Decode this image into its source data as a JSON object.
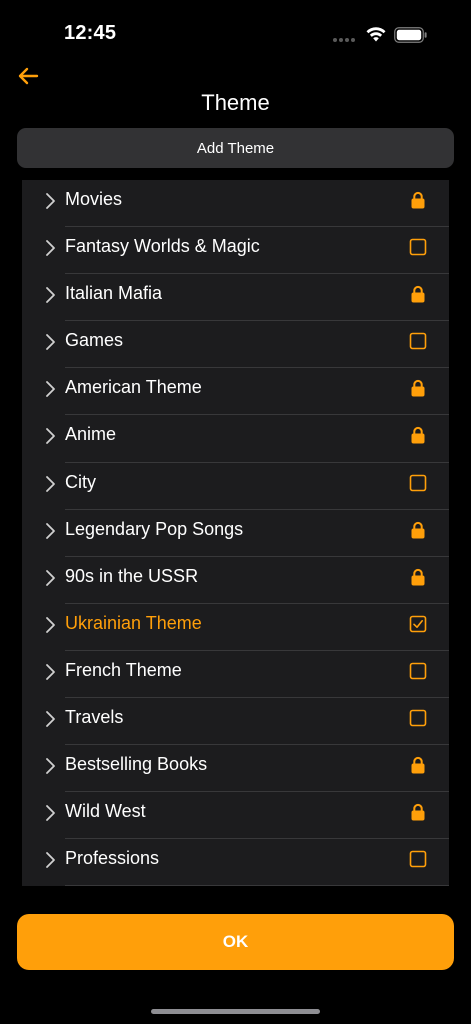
{
  "status_bar": {
    "time": "12:45",
    "wifi_icon": "wifi-icon",
    "battery_icon": "battery-icon"
  },
  "nav": {
    "back_icon": "arrow-left-icon",
    "title": "Theme"
  },
  "add_theme_label": "Add Theme",
  "themes": [
    {
      "label": "Movies",
      "status": "locked"
    },
    {
      "label": "Fantasy Worlds & Magic",
      "status": "unchecked"
    },
    {
      "label": "Italian Mafia",
      "status": "locked"
    },
    {
      "label": "Games",
      "status": "unchecked"
    },
    {
      "label": "American Theme",
      "status": "locked"
    },
    {
      "label": "Anime",
      "status": "locked"
    },
    {
      "label": "City",
      "status": "unchecked"
    },
    {
      "label": "Legendary Pop Songs",
      "status": "locked"
    },
    {
      "label": "90s in the USSR",
      "status": "locked"
    },
    {
      "label": "Ukrainian Theme",
      "status": "checked"
    },
    {
      "label": "French Theme",
      "status": "unchecked"
    },
    {
      "label": "Travels",
      "status": "unchecked"
    },
    {
      "label": "Bestselling Books",
      "status": "locked"
    },
    {
      "label": "Wild West",
      "status": "locked"
    },
    {
      "label": "Professions",
      "status": "unchecked"
    }
  ],
  "ok_label": "OK",
  "colors": {
    "accent": "#ff9f0a",
    "background": "#000000",
    "list_background": "#1c1c1e",
    "button_gray": "#323234",
    "text": "#ffffff"
  }
}
